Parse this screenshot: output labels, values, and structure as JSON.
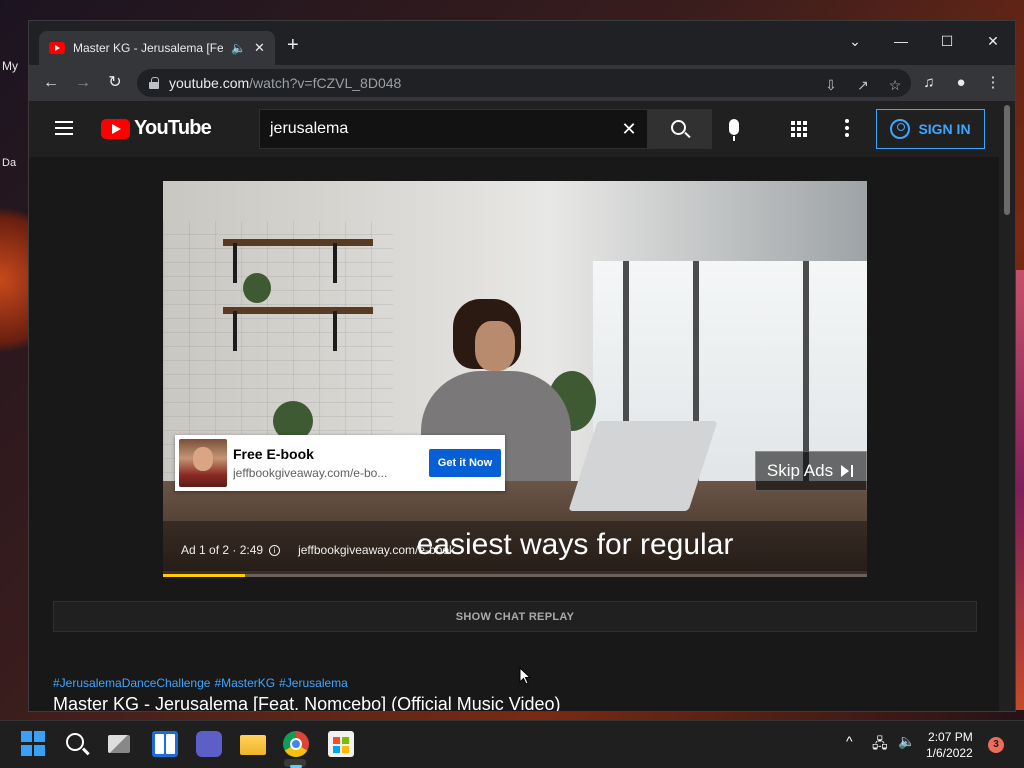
{
  "desktop": {
    "icon_label_1": "My",
    "icon_label_2": "Da"
  },
  "browser": {
    "tab": {
      "title": "Master KG - Jerusalema [Feat. Nomcebo] (Official Music Video)",
      "audio_icon": "speaker-icon",
      "close_glyph": "✕"
    },
    "new_tab_glyph": "+",
    "window_controls": {
      "dropdown": "⌄",
      "minimize": "—",
      "maximize": "☐",
      "close": "✕"
    },
    "address": {
      "domain": "youtube.com",
      "path": "/watch?v=fCZVL_8D048"
    }
  },
  "youtube": {
    "logo_text": "YouTube",
    "search": {
      "value": "jerusalema",
      "clear_glyph": "✕"
    },
    "sign_in_label": "SIGN IN",
    "ad": {
      "banner_title": "Free E-book",
      "banner_url": "jeffbookgiveaway.com/e-bo...",
      "cta_label": "Get it Now",
      "skip_label": "Skip Ads",
      "caption": "easiest ways for regular",
      "counter": "Ad 1 of 2 · 2:49",
      "info_glyph": "i",
      "footer_url": "jeffbookgiveaway.com/e-book",
      "progress": 0.117
    },
    "chat_replay_label": "SHOW CHAT REPLAY",
    "hashtags": [
      "#JerusalemaDanceChallenge",
      "#MasterKG",
      "#Jerusalema"
    ],
    "video_title": "Master KG - Jerusalema [Feat. Nomcebo] (Official Music Video)"
  },
  "taskbar": {
    "time": "2:07 PM",
    "date": "1/6/2022",
    "notification_count": "3",
    "tray_chevron": "^"
  }
}
